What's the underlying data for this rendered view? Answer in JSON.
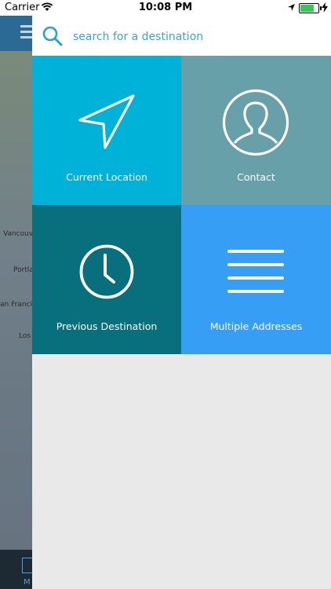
{
  "status_bar": {
    "carrier": "Carrier",
    "time": "10:08 PM",
    "icons": [
      "wifi-icon",
      "location-arrow-icon",
      "battery-icon",
      "charging-bolt-icon"
    ]
  },
  "search": {
    "placeholder": "search for a destination",
    "icon": "search-icon",
    "accent_color": "#2aa0d8"
  },
  "tiles": [
    {
      "label": "Current Location",
      "icon": "navigation-arrow-icon",
      "color": "#00b1d8"
    },
    {
      "label": "Contact",
      "icon": "contact-person-icon",
      "color": "#67a0a8"
    },
    {
      "label": "Previous Destination",
      "icon": "clock-icon",
      "color": "#08707c"
    },
    {
      "label": "Multiple Addresses",
      "icon": "list-lines-icon",
      "color": "#379ef5"
    }
  ],
  "map": {
    "cities": [
      "Vancouv",
      "Portla",
      "an Franci",
      "Los"
    ],
    "bottom_tab_label": "M"
  }
}
